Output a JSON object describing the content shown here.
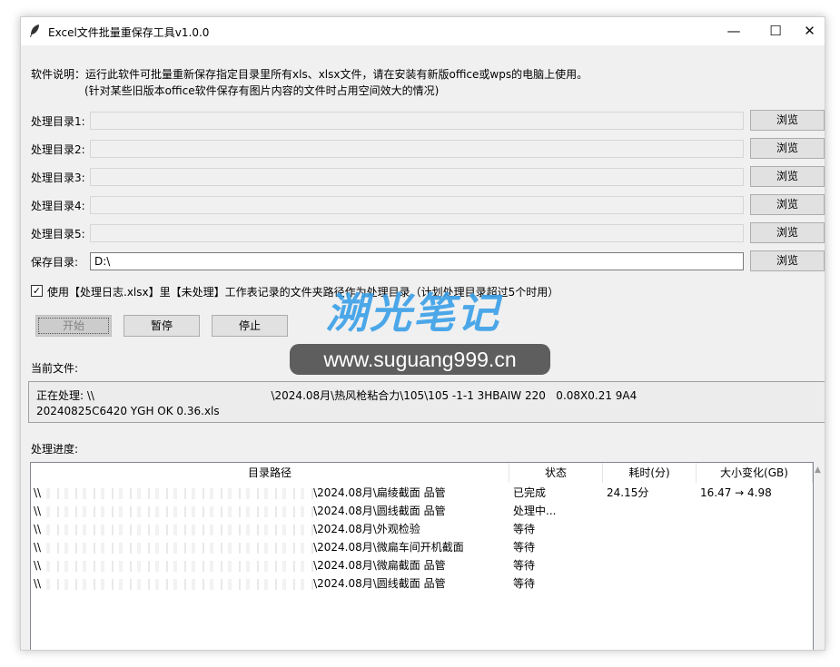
{
  "window": {
    "title": "Excel文件批量重保存工具v1.0.0",
    "controls": {
      "minimize": "—",
      "maximize": "☐",
      "close": "✕"
    }
  },
  "description": {
    "line1": "软件说明：运行此软件可批量重新保存指定目录里所有xls、xlsx文件，请在安装有新版office或wps的电脑上使用。",
    "line2": "(针对某些旧版本office软件保存有图片内容的文件时占用空间效大的情况)"
  },
  "dirs": [
    {
      "label": "处理目录1:",
      "value": "",
      "browse": "浏览"
    },
    {
      "label": "处理目录2:",
      "value": "",
      "browse": "浏览"
    },
    {
      "label": "处理目录3:",
      "value": "",
      "browse": "浏览"
    },
    {
      "label": "处理目录4:",
      "value": "",
      "browse": "浏览"
    },
    {
      "label": "处理目录5:",
      "value": "",
      "browse": "浏览"
    }
  ],
  "save_dir": {
    "label": "保存目录:",
    "value": "D:\\",
    "browse": "浏览"
  },
  "option": {
    "checked": true,
    "check_glyph": "✓",
    "label": "使用【处理日志.xlsx】里【未处理】工作表记录的文件夹路径作为处理目录（计划处理目录超过5个时用）"
  },
  "actions": {
    "start": "开始",
    "pause": "暂停",
    "stop": "停止"
  },
  "current": {
    "label": "当前文件:",
    "line1": "正在处理: \\\\                                                   \\2024.08月\\热风枪粘合力\\105\\105 -1-1 3HBAIW 220   0.08X0.21 9A4",
    "line2": "20240825C6420 YGH OK 0.36.xls"
  },
  "progress": {
    "label": "处理进度:",
    "columns": [
      "目录路径",
      "状态",
      "耗时(分)",
      "大小变化(GB)"
    ],
    "rows": [
      {
        "prefix": "\\\\",
        "path": "\\2024.08月\\扁绫截面 品管",
        "status": "已完成",
        "time": "24.15分",
        "size": "16.47 → 4.98"
      },
      {
        "prefix": "\\\\",
        "path": "\\2024.08月\\圆线截面 品管",
        "status": "处理中...",
        "time": "",
        "size": ""
      },
      {
        "prefix": "\\\\",
        "path": "\\2024.08月\\外观检验",
        "status": "等待",
        "time": "",
        "size": ""
      },
      {
        "prefix": "\\\\",
        "path": "\\2024.08月\\微扁车间开机截面",
        "status": "等待",
        "time": "",
        "size": ""
      },
      {
        "prefix": "\\\\",
        "path": "\\2024.08月\\微扁截面 品管",
        "status": "等待",
        "time": "",
        "size": ""
      },
      {
        "prefix": "\\\\",
        "path": "\\2024.08月\\圆线截面 品管",
        "status": "等待",
        "time": "",
        "size": ""
      }
    ]
  },
  "watermark": {
    "text": "溯光笔记",
    "url": "www.suguang999.cn"
  }
}
